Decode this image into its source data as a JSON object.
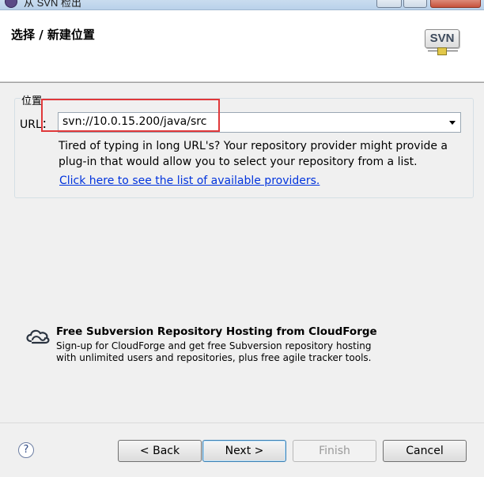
{
  "window": {
    "title": "从 SVN 检出"
  },
  "header": {
    "title": "选择 / 新建位置",
    "logo_text": "SVN"
  },
  "location": {
    "group_label": "位置",
    "url_label": "URL：",
    "url_value": "svn://10.0.15.200/java/src",
    "hint": "Tired of typing in long URL's?  Your repository provider might provide a plug-in that would allow you to select your repository from a list.",
    "providers_link": "Click here to see the list of available providers."
  },
  "promo": {
    "title": "Free Subversion Repository Hosting from CloudForge",
    "line1": "Sign-up for CloudForge and get free Subversion repository hosting",
    "line2": "with unlimited users and repositories, plus free agile tracker tools."
  },
  "buttons": {
    "help": "?",
    "back": "< Back",
    "next": "Next >",
    "finish": "Finish",
    "cancel": "Cancel"
  },
  "colors": {
    "highlight": "#e0383a",
    "link": "#0033dd"
  }
}
